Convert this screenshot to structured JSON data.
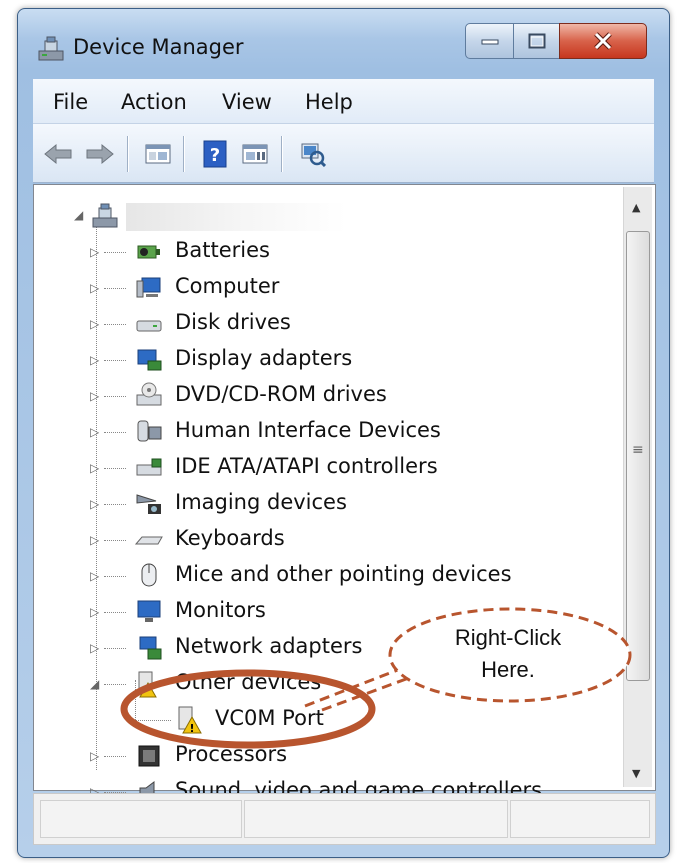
{
  "window": {
    "title": "Device Manager"
  },
  "menu": [
    "File",
    "Action",
    "View",
    "Help"
  ],
  "toolbar": {
    "buttons": [
      "back-icon",
      "forward-icon",
      "show-hide-console-tree-icon",
      "help-icon",
      "properties-icon",
      "scan-hardware-icon"
    ]
  },
  "tree": {
    "root_label": "",
    "items": [
      {
        "label": "Batteries",
        "icon": "battery-icon"
      },
      {
        "label": "Computer",
        "icon": "computer-icon"
      },
      {
        "label": "Disk drives",
        "icon": "disk-drive-icon"
      },
      {
        "label": "Display adapters",
        "icon": "display-adapter-icon"
      },
      {
        "label": "DVD/CD-ROM drives",
        "icon": "dvd-drive-icon"
      },
      {
        "label": "Human Interface Devices",
        "icon": "hid-icon"
      },
      {
        "label": "IDE ATA/ATAPI controllers",
        "icon": "ide-controller-icon"
      },
      {
        "label": "Imaging devices",
        "icon": "camera-icon"
      },
      {
        "label": "Keyboards",
        "icon": "keyboard-icon"
      },
      {
        "label": "Mice and other pointing devices",
        "icon": "mouse-icon"
      },
      {
        "label": "Monitors",
        "icon": "monitor-icon"
      },
      {
        "label": "Network adapters",
        "icon": "network-adapter-icon"
      },
      {
        "label": "Other devices",
        "icon": "unknown-device-icon"
      },
      {
        "label": "VC0M Port",
        "icon": "warning-device-icon"
      },
      {
        "label": "Processors",
        "icon": "processor-icon"
      },
      {
        "label": "Sound, video and game controllers",
        "icon": "speaker-icon"
      }
    ]
  },
  "callout": {
    "line1": "Right-Click",
    "line2": "Here."
  },
  "colors": {
    "annotation": "#b8552e",
    "title_bar": "#a9c6e6",
    "close_button": "#c6361e"
  }
}
